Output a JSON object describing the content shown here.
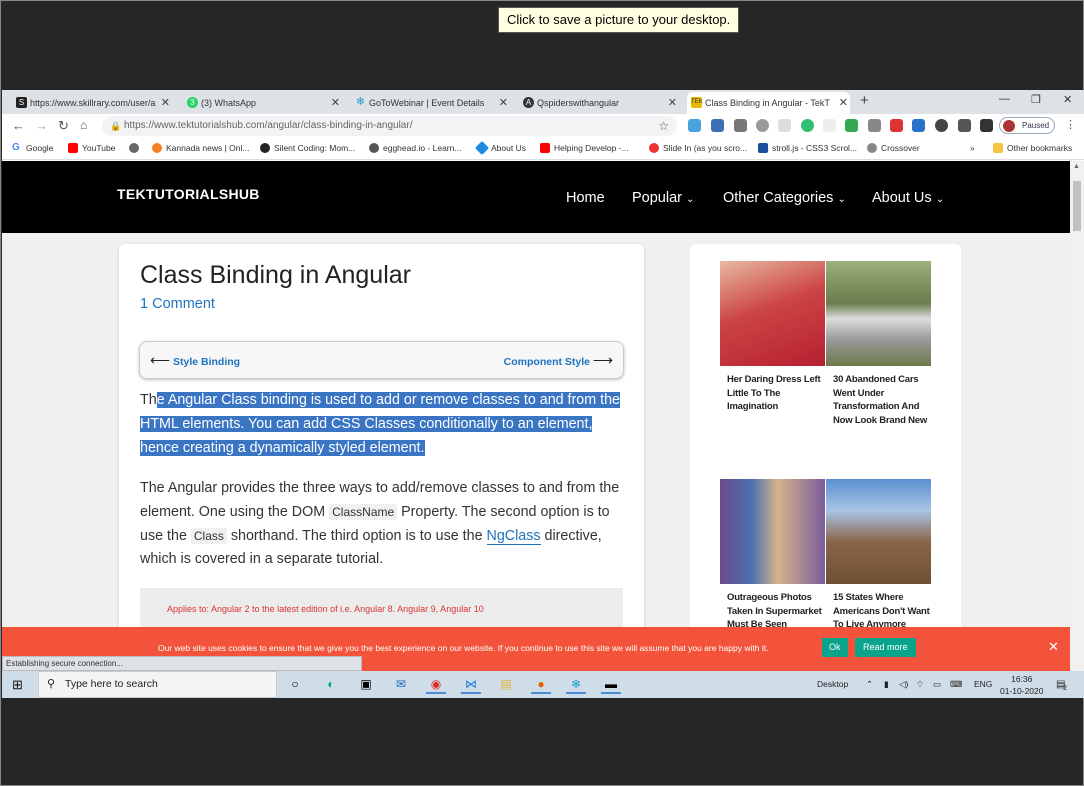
{
  "tooltip": "Click to save a picture to your desktop.",
  "tabs": [
    {
      "label": "https://www.skillrary.com/user/a",
      "icon": "skillrary-icon",
      "color": "#222"
    },
    {
      "label": "(3) WhatsApp",
      "icon": "whatsapp-icon",
      "color": "#25d366"
    },
    {
      "label": "GoToWebinar | Event Details",
      "icon": "gotowebinar-icon",
      "color": "#1b9ad6"
    },
    {
      "label": "Qspiderswithangular",
      "icon": "angular-icon",
      "color": "#333"
    },
    {
      "label": "Class Binding in Angular - TekTut",
      "icon": "tek-icon",
      "color": "#e6b800"
    }
  ],
  "address": "https://www.tektutorialshub.com/angular/class-binding-in-angular/",
  "profile_status": "Paused",
  "bookmarks": [
    "Google",
    "YouTube",
    "",
    "Kannada news | Onl...",
    "Silent Coding: Mom...",
    "egghead.io - Learn...",
    "About Us",
    "Helping Develop -...",
    "Slide In (as you scro...",
    "stroll.js - CSS3 Scrol...",
    "Crossover"
  ],
  "other_bookmarks": "Other bookmarks",
  "site": {
    "logo": "TEKTUTORIALSHUB",
    "menu": [
      "Home",
      "Popular",
      "Other Categories",
      "About Us"
    ]
  },
  "article": {
    "title": "Class Binding in Angular",
    "comments": "1 Comment",
    "prev": "Style Binding",
    "next": "Component Style",
    "p1_plain": "Th",
    "p1_selected": "e Angular Class binding is used to add or remove classes to and from the HTML elements. You can add CSS Classes conditionally to an element, hence creating a dynamically styled element.",
    "p2_a": "The Angular provides the three ways to add/remove classes to and from the element. One using the DOM ",
    "p2_code1": "ClassName",
    "p2_b": " Property. The second option is to use the ",
    "p2_code2": "Class",
    "p2_c": " shorthand. The third option is to use the ",
    "p2_link": "NgClass",
    "p2_d": " directive, which is covered in a separate tutorial.",
    "note": "Applies to: Angular 2 to the latest edition of i.e. Angular 8. Angular 9, Angular 10"
  },
  "sidebar_cards": [
    "Her Daring Dress Left Little To The Imagination",
    "30 Abandoned Cars Went Under Transformation And Now Look Brand New",
    "Outrageous Photos Taken In Supermarket Must Be Seen",
    "15 States Where Americans Don't Want To Live Anymore"
  ],
  "cookie": {
    "message": "Our web site uses cookies to ensure that we give you the best experience on our website. If you continue to use this site we will assume that you are happy with it.",
    "ok": "Ok",
    "read_more": "Read more"
  },
  "status_text": "Establishing secure connection...",
  "taskbar": {
    "search_placeholder": "Type here to search",
    "desktop": "Desktop",
    "lang": "ENG",
    "time": "16:36",
    "date": "01-10-2020",
    "notifications": "2"
  }
}
